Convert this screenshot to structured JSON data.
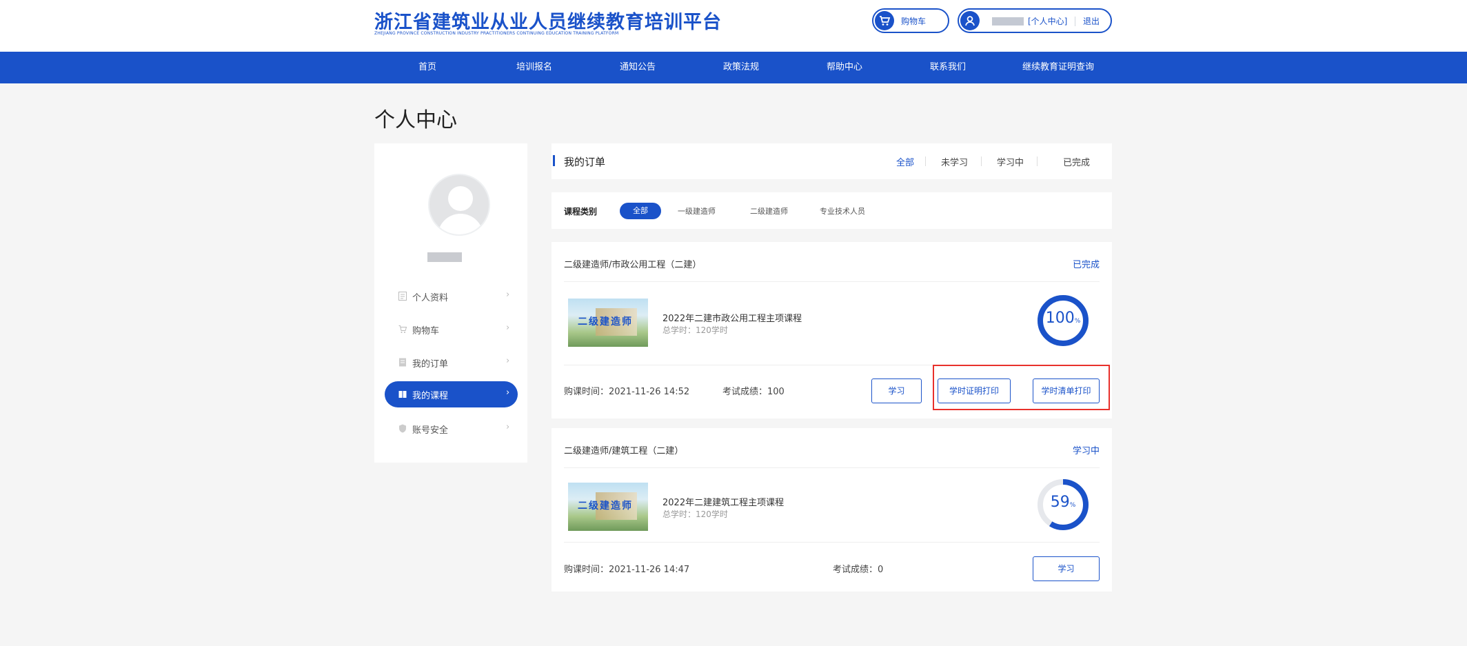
{
  "header": {
    "title": "浙江省建筑业从业人员继续教育培训平台",
    "subtitle": "ZHEJIANG PROVINCE CONSTRUCTION INDUSTRY PRACTITIONERS CONTINUING EDUCATION TRAINING PLATFORM",
    "cart_label": "购物车",
    "personal_center_link": "[个人中心]",
    "logout_link": "退出"
  },
  "nav": {
    "items": [
      "首页",
      "培训报名",
      "通知公告",
      "政策法规",
      "帮助中心",
      "联系我们",
      "继续教育证明查询"
    ]
  },
  "page": {
    "title": "个人中心"
  },
  "sidebar": {
    "items": [
      {
        "label": "个人资料",
        "icon": "id-card-icon"
      },
      {
        "label": "购物车",
        "icon": "cart-icon"
      },
      {
        "label": "我的订单",
        "icon": "order-icon"
      },
      {
        "label": "我的课程",
        "icon": "book-icon",
        "active": true
      },
      {
        "label": "账号安全",
        "icon": "shield-icon"
      }
    ],
    "chevron": "›"
  },
  "orders": {
    "title": "我的订单",
    "filters": [
      "全部",
      "未学习",
      "学习中",
      "已完成"
    ],
    "active_filter": "全部"
  },
  "category": {
    "label": "课程类别",
    "options": [
      "全部",
      "一级建造师",
      "二级建造师",
      "专业技术人员"
    ]
  },
  "courses": [
    {
      "category": "二级建造师/市政公用工程（二建）",
      "status": "已完成",
      "thumb_text": "二级建造师",
      "name": "2022年二建市政公用工程主项课程",
      "hours": "总学时：120学时",
      "progress": 100,
      "progress_text": "100",
      "unit": "%",
      "purchase_time": "购课时间：2021-11-26 14:52",
      "exam_score": "考试成绩：100",
      "buttons": [
        "学习",
        "学时证明打印",
        "学时清单打印"
      ]
    },
    {
      "category": "二级建造师/建筑工程（二建）",
      "status": "学习中",
      "thumb_text": "二级建造师",
      "name": "2022年二建建筑工程主项课程",
      "hours": "总学时：120学时",
      "progress": 59,
      "progress_text": "59",
      "unit": "%",
      "purchase_time": "购课时间：2021-11-26 14:47",
      "exam_score": "考试成绩：0",
      "buttons": [
        "学习"
      ]
    }
  ],
  "colors": {
    "primary": "#1a52c9",
    "highlight": "#e8302b",
    "ring_track": "#e6e8ec"
  }
}
